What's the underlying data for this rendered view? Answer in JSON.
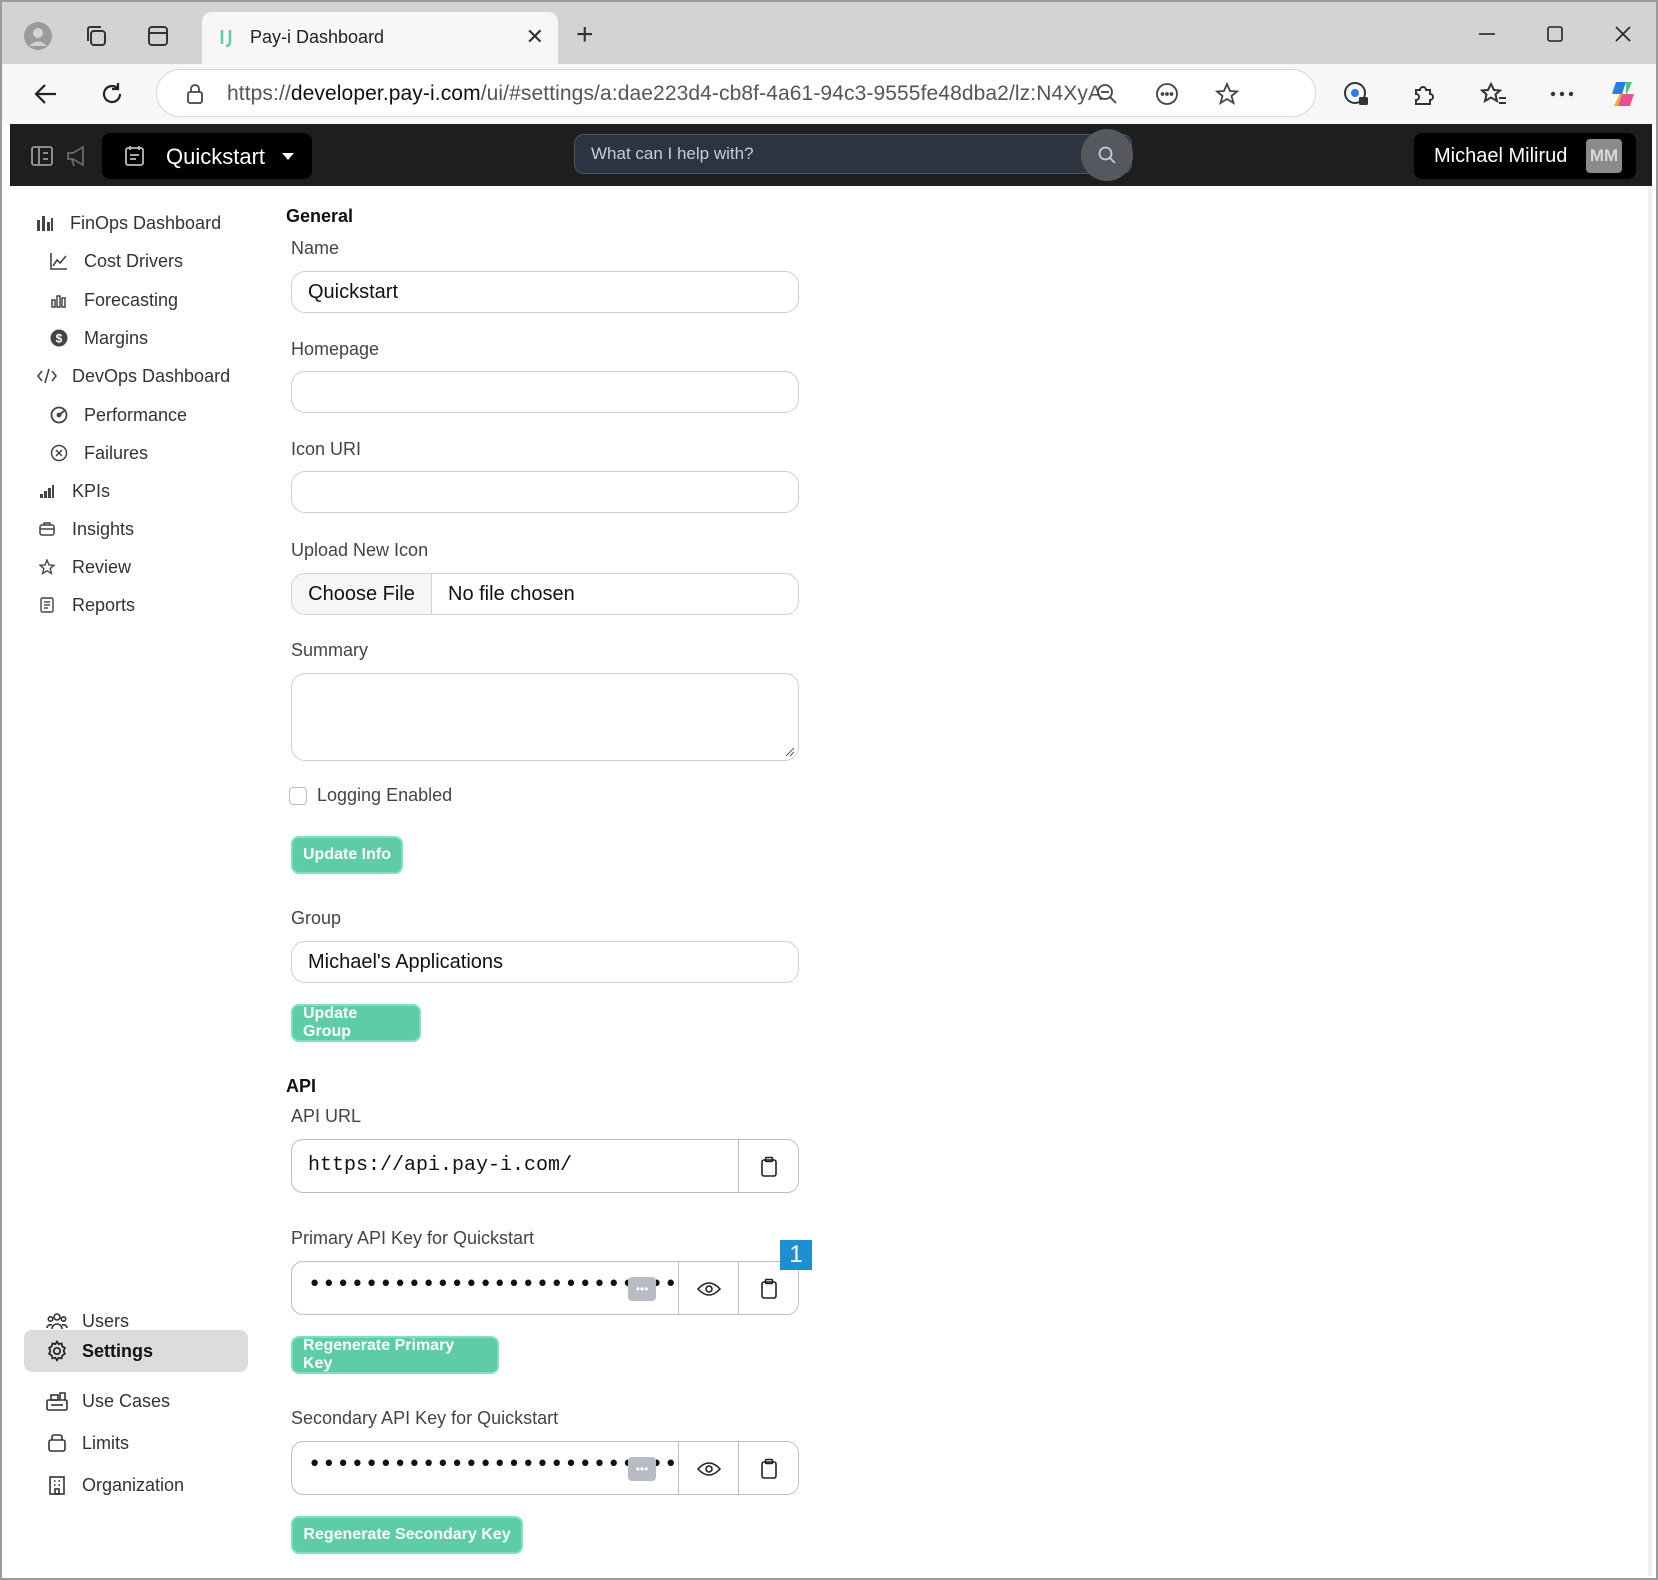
{
  "browser": {
    "tab_title": "Pay-i Dashboard",
    "url_scheme": "https://",
    "url_host": "developer.pay-i.com",
    "url_path": "/ui/#settings/a:dae223d4-cb8f-4a61-94c3-9555fe48dba2/lz:N4XyA",
    "new_tab_label": "+",
    "close_tab_label": "✕"
  },
  "header": {
    "app_name": "Quickstart",
    "search_placeholder": "What can I help with?",
    "user_name": "Michael Milirud",
    "user_initials": "MM"
  },
  "sidebar": {
    "items": [
      {
        "label": "FinOps Dashboard",
        "icon": "bar-chart-icon"
      },
      {
        "label": "Cost Drivers",
        "icon": "line-chart-icon"
      },
      {
        "label": "Forecasting",
        "icon": "forecast-bars-icon"
      },
      {
        "label": "Margins",
        "icon": "dollar-circle-icon"
      },
      {
        "label": "DevOps Dashboard",
        "icon": "code-icon"
      },
      {
        "label": "Performance",
        "icon": "speedometer-icon"
      },
      {
        "label": "Failures",
        "icon": "x-circle-icon"
      },
      {
        "label": "KPIs",
        "icon": "kpi-bars-icon"
      },
      {
        "label": "Insights",
        "icon": "insights-icon"
      },
      {
        "label": "Review",
        "icon": "star-icon"
      },
      {
        "label": "Reports",
        "icon": "document-icon"
      }
    ],
    "bottom_items": [
      {
        "label": "Users",
        "icon": "users-icon"
      },
      {
        "label": "Settings",
        "icon": "gear-icon"
      },
      {
        "label": "Use Cases",
        "icon": "use-cases-icon"
      },
      {
        "label": "Limits",
        "icon": "limits-icon"
      },
      {
        "label": "Organization",
        "icon": "building-icon"
      }
    ],
    "active": "Settings"
  },
  "general": {
    "section_title": "General",
    "name_label": "Name",
    "name_value": "Quickstart",
    "homepage_label": "Homepage",
    "homepage_value": "",
    "icon_uri_label": "Icon URI",
    "icon_uri_value": "",
    "upload_label": "Upload New Icon",
    "choose_file_label": "Choose File",
    "no_file_label": "No file chosen",
    "summary_label": "Summary",
    "logging_label": "Logging Enabled",
    "logging_enabled": false,
    "update_info_label": "Update Info",
    "group_label": "Group",
    "group_value": "Michael's Applications",
    "update_group_label": "Update Group"
  },
  "api": {
    "section_title": "API",
    "url_label": "API URL",
    "url_value": "https://api.pay-i.com/",
    "primary_label": "Primary API Key for Quickstart",
    "primary_masked": "••••••••••••••••••••••••••••",
    "regen_primary_label": "Regenerate Primary Key",
    "secondary_label": "Secondary API Key for Quickstart",
    "secondary_masked": "••••••••••••••••••••••••••••",
    "regen_secondary_label": "Regenerate Secondary Key",
    "badge_number": "1"
  },
  "colors": {
    "accent_green": "#5fcca8",
    "badge_blue": "#1b8fd1",
    "header_bg": "#1e1e1e"
  }
}
